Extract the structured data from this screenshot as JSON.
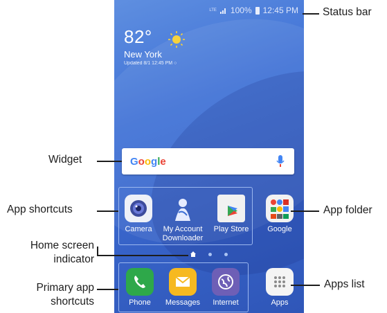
{
  "status_bar": {
    "lte": "LTE",
    "battery": "100%",
    "time": "12:45 PM"
  },
  "weather": {
    "temp": "82°",
    "city": "New York",
    "updated": "Updated 8/1 12:45 PM"
  },
  "search": {
    "logo": "Google"
  },
  "apps": [
    {
      "label": "Camera",
      "icon": "camera-icon"
    },
    {
      "label": "My Account Downloader",
      "icon": "my-account-downloader-icon"
    },
    {
      "label": "Play Store",
      "icon": "play-store-icon"
    },
    {
      "label": "Google",
      "icon": "google-folder-icon"
    }
  ],
  "dock": [
    {
      "label": "Phone",
      "icon": "phone-icon"
    },
    {
      "label": "Messages",
      "icon": "messages-icon"
    },
    {
      "label": "Internet",
      "icon": "internet-icon"
    },
    {
      "label": "Apps",
      "icon": "apps-grid-icon"
    }
  ],
  "callouts": {
    "status_bar": "Status bar",
    "widget": "Widget",
    "app_shortcuts": "App shortcuts",
    "app_folder": "App folder",
    "home_indicator": "Home screen indicator",
    "apps_list": "Apps list",
    "primary_shortcuts": "Primary app shortcuts"
  },
  "colors": {
    "wallpaper": "#3f71d6",
    "phone_icon": "#2ea84a",
    "messages_icon": "#f6b920",
    "internet_icon": "#6e5fb6",
    "highlight": "#9bb7ef"
  }
}
